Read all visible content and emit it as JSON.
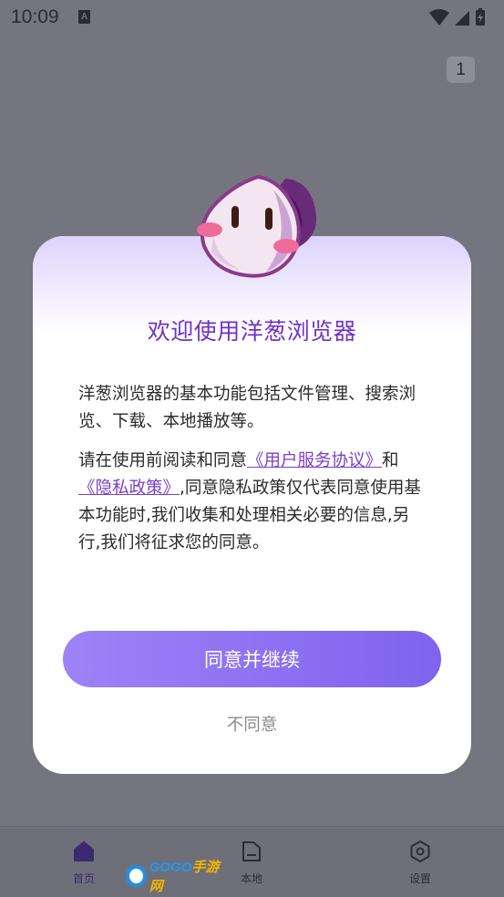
{
  "status_bar": {
    "time": "10:09",
    "notification_icon": "A"
  },
  "browser": {
    "tab_count": "1"
  },
  "bottom_nav": {
    "items": [
      {
        "label": "首页",
        "icon": "home-icon"
      },
      {
        "label": "本地",
        "icon": "folder-icon"
      },
      {
        "label": "设置",
        "icon": "settings-icon"
      }
    ]
  },
  "watermark": {
    "text_a": "GOGO",
    "text_b": "手游网"
  },
  "dialog": {
    "title": "欢迎使用洋葱浏览器",
    "paragraph1": "洋葱浏览器的基本功能包括文件管理、搜索浏览、下载、本地播放等。",
    "paragraph2_prefix": "请在使用前阅读和同意",
    "user_agreement_link": "《用户服务协议》",
    "paragraph2_mid": "和",
    "privacy_link": "《隐私政策》",
    "paragraph2_suffix": ",同意隐私政策仅代表同意使用基本功能时,我们收集和处理相关必要的信息,另行,我们将征求您的同意。",
    "agree_button": "同意并继续",
    "decline_button": "不同意"
  },
  "colors": {
    "accent": "#7e63ee",
    "title": "#6f33c7",
    "link": "#7b3fc9",
    "scrim": "#75757f"
  }
}
